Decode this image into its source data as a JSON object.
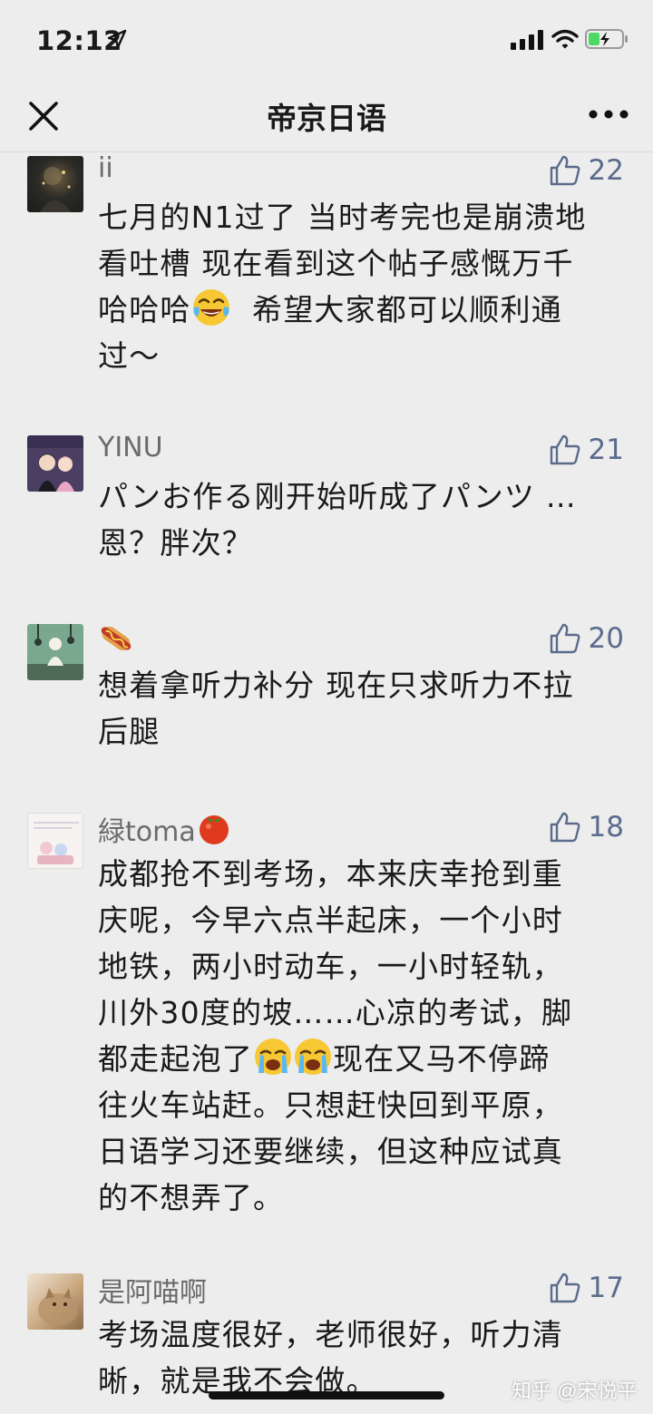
{
  "status_bar": {
    "time": "12:12"
  },
  "nav": {
    "title": "帝京日语"
  },
  "comments": [
    {
      "author": "ii",
      "likes": "22",
      "lines": [
        "七月的N1过了 当时考完也是崩溃地",
        "看吐槽 现在看到这个帖子感慨万千",
        "哈哈哈",
        "  希望大家都可以顺利通",
        "过～"
      ]
    },
    {
      "author": "YINU",
      "likes": "21",
      "lines": [
        "パンお作る刚开始听成了パンツ …",
        "恩？胖次？"
      ]
    },
    {
      "author": "",
      "likes": "20",
      "lines": [
        "想着拿听力补分 现在只求听力不拉",
        "后腿"
      ]
    },
    {
      "author": "緑toma",
      "likes": "18",
      "lines": [
        "成都抢不到考场，本来庆幸抢到重",
        "庆呢，今早六点半起床，一个小时",
        "地铁，两小时动车，一小时轻轨，",
        "川外30度的坡……心凉的考试，脚",
        "都走起泡了",
        "现在又马不停蹄",
        "往火车站赶。只想赶快回到平原，",
        "日语学习还要继续，但这种应试真",
        "的不想弄了。"
      ]
    },
    {
      "author": "是阿喵啊",
      "likes": "17",
      "lines": [
        "考场温度很好，老师很好，听力清",
        "晰，就是我不会做。"
      ]
    }
  ],
  "watermark": "知乎 @宋悦平",
  "colors": {
    "background": "#ededed",
    "like_blue": "#5b6b8c",
    "author_gray": "#6b6b6b"
  },
  "icons": [
    "location-arrow-icon",
    "cellular-signal-icon",
    "wifi-icon",
    "battery-charging-icon",
    "close-icon",
    "more-icon",
    "thumbs-up-icon",
    "laughing-tears-emoji",
    "hot-dog-emoji",
    "tomato-emoji",
    "crying-emoji"
  ]
}
